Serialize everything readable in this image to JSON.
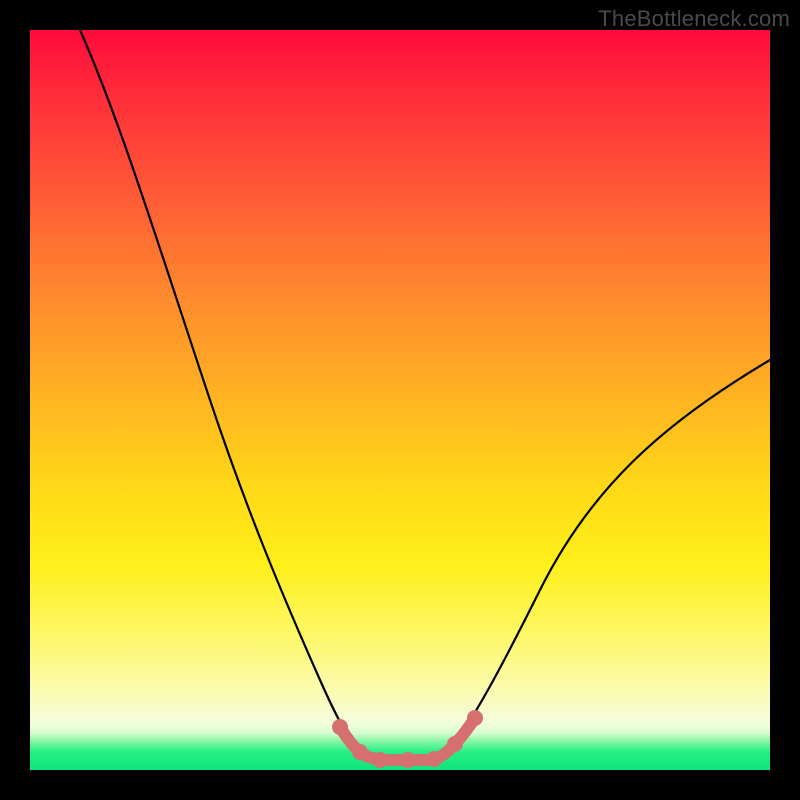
{
  "watermark": "TheBottleneck.com",
  "chart_data": {
    "type": "line",
    "title": "",
    "xlabel": "",
    "ylabel": "",
    "xlim": [
      0,
      100
    ],
    "ylim": [
      0,
      100
    ],
    "grid": false,
    "legend": false,
    "series": [
      {
        "name": "main-curve",
        "x": [
          7,
          10,
          15,
          20,
          25,
          30,
          35,
          38,
          41,
          43,
          45,
          47,
          50,
          53,
          56,
          60,
          65,
          70,
          80,
          90,
          100
        ],
        "values": [
          100,
          90,
          75,
          61,
          48,
          36,
          24,
          16,
          9,
          5,
          2.5,
          1.3,
          1.0,
          1.3,
          3,
          8,
          17,
          25,
          38,
          48,
          56
        ]
      },
      {
        "name": "bottleneck-region",
        "x": [
          41,
          43,
          45,
          47,
          50,
          53,
          56
        ],
        "values": [
          9,
          5,
          2.5,
          1.3,
          1.0,
          1.3,
          3
        ]
      }
    ],
    "annotations": []
  },
  "colors": {
    "watermark": "#4a4a4a",
    "curve": "#000000",
    "accent": "#d6706f"
  }
}
